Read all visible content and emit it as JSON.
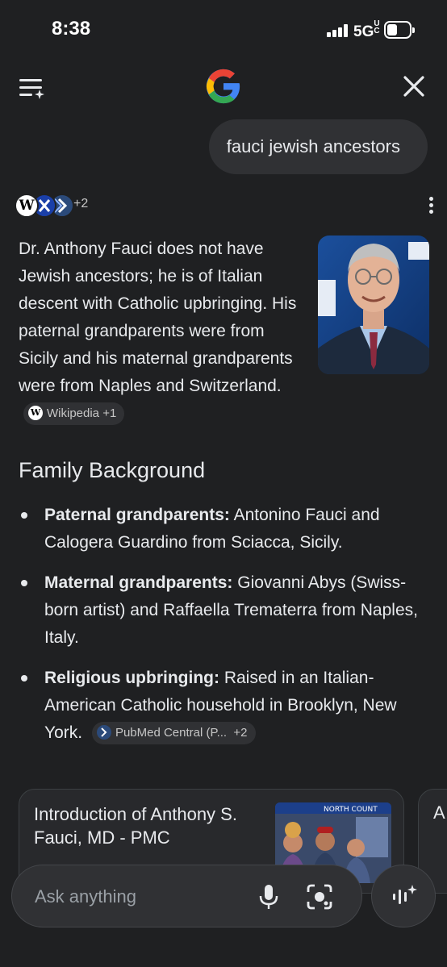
{
  "status": {
    "time": "8:38",
    "network": "5G",
    "network_suffix": "UC"
  },
  "header": {
    "menu_icon": "menu-sparkle-icon",
    "logo_icon": "google-g-icon",
    "close_icon": "close-icon"
  },
  "query": {
    "text": "fauci jewish ancestors"
  },
  "sources": {
    "icons": [
      "wikipedia-icon",
      "site-icon",
      "pubmed-icon"
    ],
    "extra_count": "+2"
  },
  "answer": {
    "text": "Dr. Anthony Fauci does not have Jewish ancestors; he is of Italian descent with Catholic upbringing. His paternal grandparents were from Sicily and his maternal grandparents were from Naples and Switzerland.",
    "chip_label": "Wikipedia +1"
  },
  "family": {
    "title": "Family Background",
    "items": [
      {
        "label": "Paternal grandparents:",
        "text": "Antonino Fauci and Calogera Guardino from Sciacca, Sicily."
      },
      {
        "label": "Maternal grandparents:",
        "text": "Giovanni Abys (Swiss-born artist) and Raffaella Trematerra from Naples, Italy."
      },
      {
        "label": "Religious upbringing:",
        "text": "Raised in an Italian-American Catholic household in Brooklyn, New York.",
        "chip_label": "PubMed Central (P...",
        "chip_count": "+2"
      }
    ]
  },
  "cards": [
    {
      "title": "Introduction of Anthony S. Fauci, MD - PMC",
      "subtitle": ""
    },
    {
      "title": "A"
    }
  ],
  "composer": {
    "placeholder": "Ask anything"
  },
  "colors": {
    "background": "#1f2022",
    "surface": "#303134",
    "text": "#e8eaed"
  }
}
